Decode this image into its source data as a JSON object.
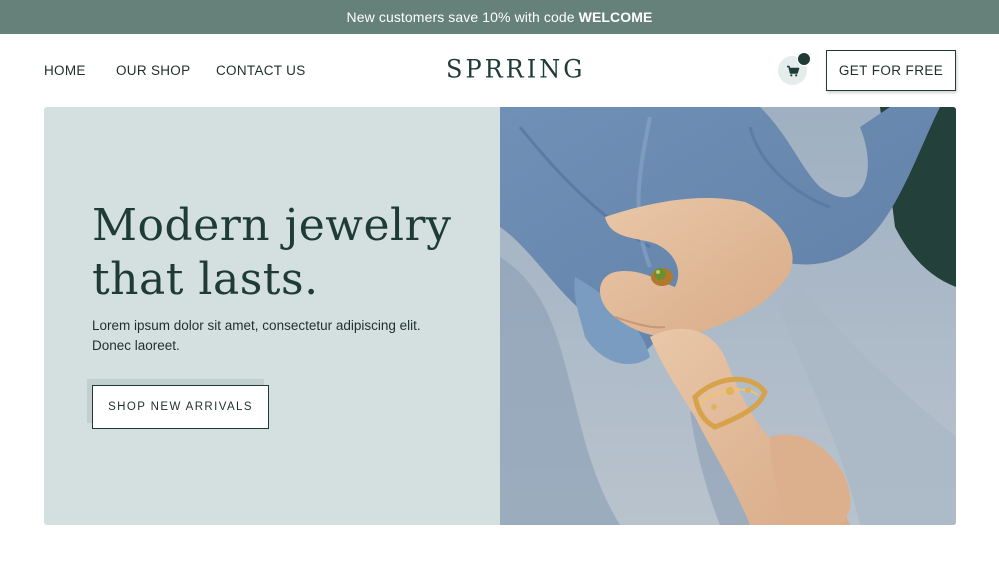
{
  "promo": {
    "text": "New customers save 10% with code",
    "code": "WELCOME"
  },
  "nav": {
    "links": [
      "HOME",
      "OUR SHOP",
      "CONTACT US"
    ],
    "logo": "SPRRING",
    "cart_icon": "shopping-cart-icon",
    "cta": "GET FOR FREE"
  },
  "hero": {
    "title_line1": "Modern jewelry",
    "title_line2": "that lasts.",
    "body": "Lorem ipsum dolor sit amet, consectetur adipiscing elit. Donec laoreet.",
    "button": "SHOP NEW ARRIVALS",
    "image_subject": "hand-with-ring-and-bracelet"
  },
  "colors": {
    "promo_bg": "#66807a",
    "brand_dark": "#1f3b36",
    "hero_panel_bg": "#d4e0e0"
  }
}
